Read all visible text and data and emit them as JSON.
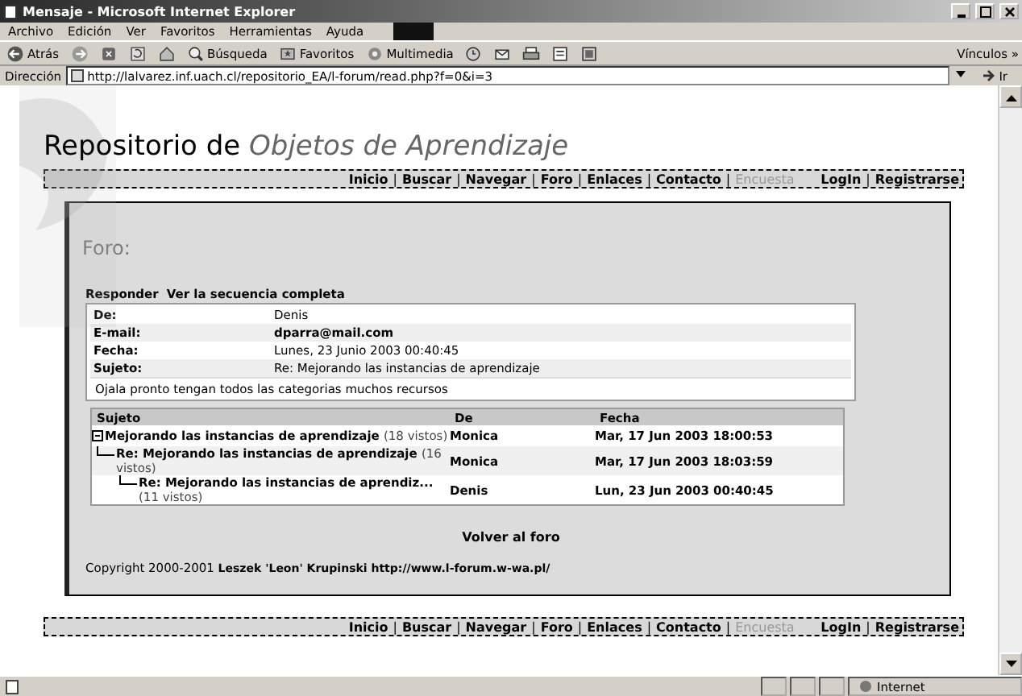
{
  "window": {
    "title": "Mensaje - Microsoft Internet Explorer"
  },
  "menu": [
    "Archivo",
    "Edición",
    "Ver",
    "Favoritos",
    "Herramientas",
    "Ayuda"
  ],
  "toolbar": [
    {
      "kind": "back",
      "label": "Atrás"
    },
    {
      "kind": "forward"
    },
    {
      "kind": "stop"
    },
    {
      "kind": "refresh"
    },
    {
      "kind": "home"
    },
    {
      "kind": "search",
      "label": "Búsqueda"
    },
    {
      "kind": "favorites",
      "label": "Favoritos"
    },
    {
      "kind": "media",
      "label": "Multimedia"
    },
    {
      "kind": "history"
    },
    {
      "kind": "mail"
    },
    {
      "kind": "print"
    },
    {
      "kind": "edit"
    },
    {
      "kind": "page"
    }
  ],
  "links": {
    "label": "Vínculos",
    "more": "»"
  },
  "address": {
    "label": "Dirección",
    "url": "http://lalvarez.inf.uach.cl/repositorio_EA/l-forum/read.php?f=0&i=3",
    "go": "Ir"
  },
  "heading": {
    "plain": "Repositorio de",
    "italic": "Objetos de Aprendizaje"
  },
  "nav_top": {
    "separator": "|",
    "left": [
      {
        "label": "Inicio",
        "disabled": false
      },
      {
        "label": "Buscar",
        "disabled": false
      },
      {
        "label": "Navegar",
        "disabled": false
      },
      {
        "label": "Foro",
        "disabled": false
      },
      {
        "label": "Enlaces",
        "disabled": false
      },
      {
        "label": "Contacto",
        "disabled": false
      },
      {
        "label": "Encuesta",
        "disabled": true
      }
    ],
    "right": [
      {
        "label": "LogIn",
        "disabled": false
      },
      {
        "label": "Registrarse",
        "disabled": false
      }
    ]
  },
  "forum": {
    "title": "Foro:",
    "actions": [
      "Responder",
      "Ver la secuencia completa"
    ],
    "fields": [
      {
        "label": "De:",
        "value": "Denis",
        "kind": "text"
      },
      {
        "label": "E-mail:",
        "value": "dparra@mail.com",
        "kind": "link"
      },
      {
        "label": "Fecha:",
        "value": "Lunes, 23 Junio 2003 00:40:45",
        "kind": "text"
      },
      {
        "label": "Sujeto:",
        "value": "Re: Mejorando las instancias de aprendizaje",
        "kind": "text"
      }
    ],
    "body": "Ojala pronto tengan todos las categorias muchos recursos",
    "thread": {
      "columns": [
        "Sujeto",
        "De",
        "Fecha"
      ],
      "rows": [
        {
          "subject": "Mejorando las instancias de aprendizaje",
          "views": "(18 vistos)",
          "author": "Monica",
          "date": "Mar, 17 Jun 2003 18:00:53",
          "expanded": true,
          "children": [
            {
              "subject": "Re: Mejorando las instancias de aprendizaje",
              "views": "(16 vistos)",
              "author": "Monica",
              "date": "Mar, 17 Jun 2003 18:03:59",
              "children": [
                {
                  "subject": "Re: Mejorando las instancias de aprendiz...",
                  "views": "(11 vistos)",
                  "author": "Denis",
                  "date": "Lun, 23 Jun 2003 00:40:45"
                }
              ]
            }
          ]
        }
      ]
    },
    "back": "Volver al foro",
    "copyright": {
      "prefix": "Copyright 2000-2001",
      "rest": "Leszek 'Leon' Krupinski http://www.l-forum.w-wa.pl/"
    }
  },
  "nav_bottom": {
    "separator": "|",
    "left": [
      {
        "label": "Inicio",
        "disabled": false
      },
      {
        "label": "Buscar",
        "disabled": false
      },
      {
        "label": "Navegar",
        "disabled": false
      },
      {
        "label": "Foro",
        "disabled": false
      },
      {
        "label": "Enlaces",
        "disabled": false
      },
      {
        "label": "Contacto",
        "disabled": false
      },
      {
        "label": "Encuesta",
        "disabled": true
      }
    ],
    "right": [
      {
        "label": "LogIn",
        "disabled": false
      },
      {
        "label": "Registrarse",
        "disabled": false
      }
    ]
  },
  "status_bar": {
    "zone": "Internet"
  }
}
